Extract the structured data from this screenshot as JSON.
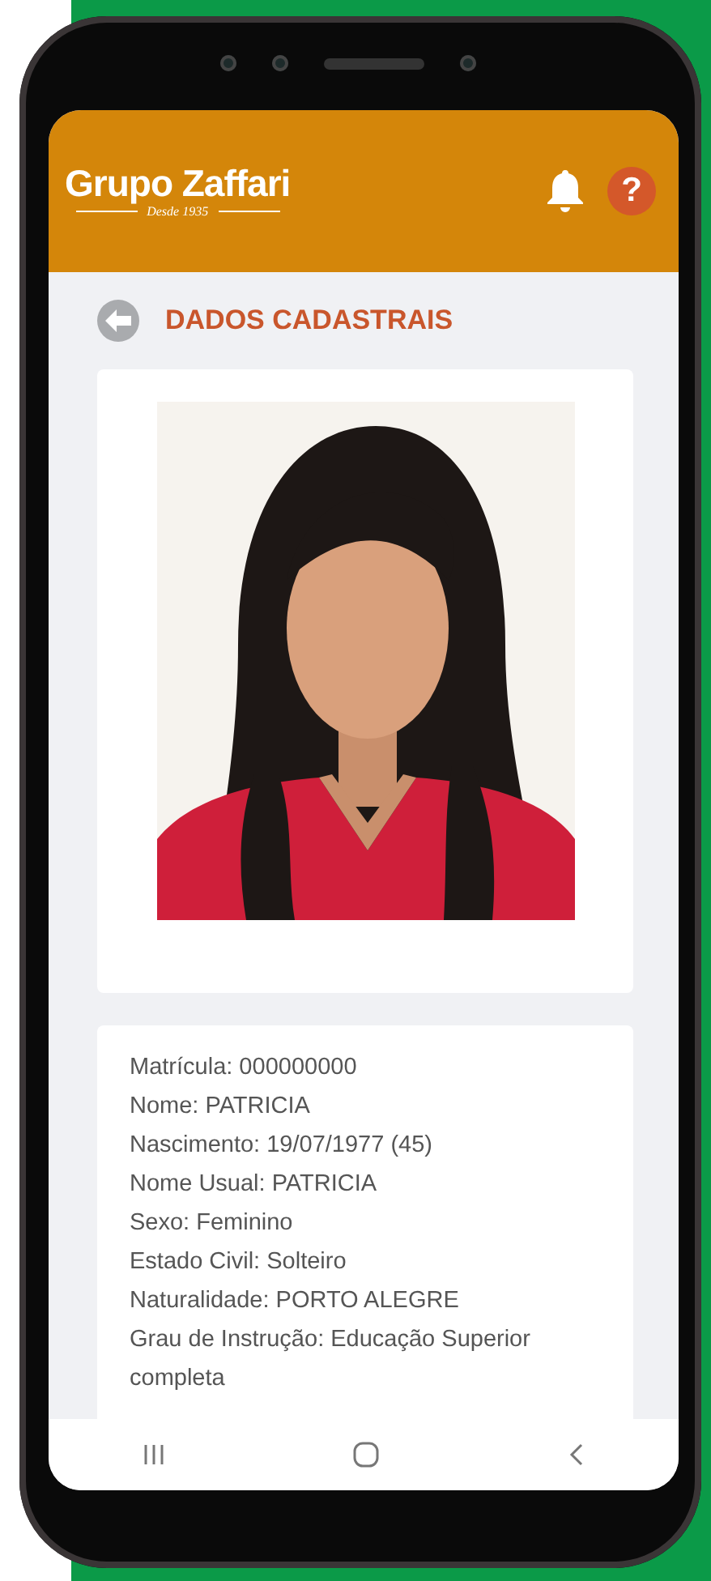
{
  "header": {
    "logo": "Grupo Zaffari",
    "tagline": "Desde 1935",
    "help_button": "?"
  },
  "page": {
    "title": "DADOS CADASTRAIS"
  },
  "details": [
    "Matrícula: 000000000",
    "Nome: PATRICIA",
    "Nascimento: 19/07/1977 (45)",
    "Nome Usual: PATRICIA",
    "Sexo: Feminino",
    "Estado Civil: Solteiro",
    "Naturalidade: PORTO ALEGRE",
    "Grau de Instrução: Educação Superior completa"
  ]
}
